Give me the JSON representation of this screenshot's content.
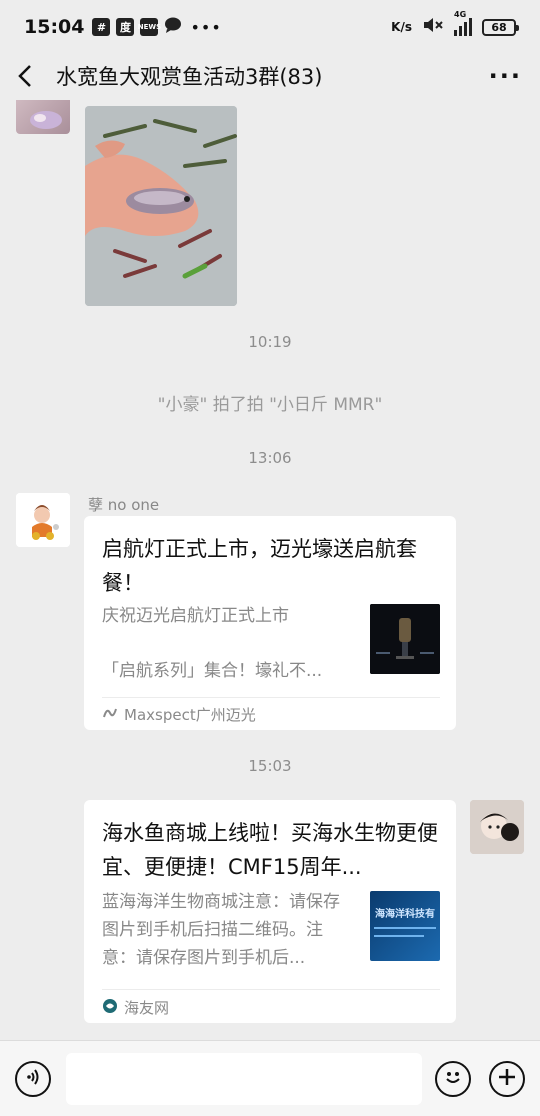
{
  "status_bar": {
    "time": "15:04",
    "icons": [
      "hash-icon",
      "baidu-icon",
      "news-icon",
      "chat-icon"
    ],
    "right_text": "K/s",
    "signal_label": "4G",
    "battery": "68"
  },
  "header": {
    "title": "水宽鱼大观赏鱼活动3群(83)",
    "more_label": "···"
  },
  "messages": {
    "time_1": "10:19",
    "system_1": "\"小豪\" 拍了拍 \"小日斤 MMR\"",
    "time_2": "13:06",
    "sender_1": "孽 no one",
    "card_1": {
      "title": "启航灯正式上市，迈光壕送启航套餐！",
      "desc_line1": "庆祝迈光启航灯正式上市",
      "desc_line2": "「启航系列」集合！壕礼不...",
      "source": "Maxspect广州迈光"
    },
    "time_3": "15:03",
    "card_2": {
      "title": "海水鱼商城上线啦！买海水生物更便宜、更便捷！CMF15周年...",
      "desc": "蓝海海洋生物商城注意：请保存图片到手机后扫描二维码。注意：请保存图片到手机后...",
      "thumb_text": "海海洋科技有",
      "source": "海友网"
    }
  },
  "input_bar": {
    "placeholder": ""
  },
  "colors": {
    "background": "#ededed",
    "card": "#ffffff",
    "muted_text": "#888888"
  }
}
